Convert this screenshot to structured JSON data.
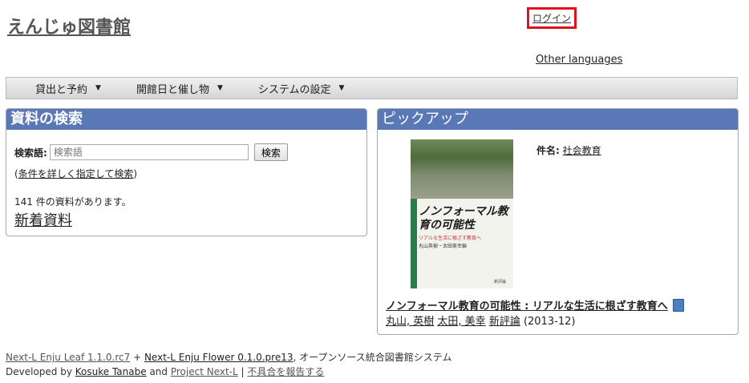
{
  "header": {
    "site_title": "えんじゅ図書館",
    "login_label": "ログイン",
    "other_languages": "Other languages"
  },
  "menu": {
    "items": [
      {
        "label": "貸出と予約"
      },
      {
        "label": "開館日と催し物"
      },
      {
        "label": "システムの設定"
      }
    ]
  },
  "search_panel": {
    "title": "資料の検索",
    "label": "検索語",
    "colon": ":",
    "placeholder": "検索語",
    "button": "検索",
    "advanced_link": "条件を詳しく指定して検索",
    "open_paren": "(",
    "close_paren": ")",
    "count_text": "141 件の資料があります。",
    "new_items_link": "新着資料"
  },
  "pickup_panel": {
    "title": "ピックアップ",
    "subject_label": "件名:",
    "subject_value": "社会教育",
    "cover": {
      "title": "ノンフォーマル教育の可能性",
      "subtitle": "リアルな生活に根ざす教育へ",
      "authors": "丸山英樹・太田美幸編",
      "publisher": "新評論"
    },
    "book_title": "ノンフォーマル教育の可能性 : リアルな生活に根ざす教育へ",
    "author1": "丸山, 英樹",
    "author2": "太田, 美幸",
    "publisher": "新評論",
    "date": "(2013-12)"
  },
  "footer": {
    "leaf": "Next-L Enju Leaf 1.1.0.rc7",
    "plus": "+",
    "flower": "Next-L Enju Flower 0.1.0.pre13",
    "tail": ", オープンソース統合図書館システム",
    "developed_by": "Developed by",
    "developer": "Kosuke Tanabe",
    "and": "and",
    "project": "Project Next-L",
    "sep": "|",
    "report": "不具合を報告する"
  },
  "colors": {
    "panel_header": "#5a77b6",
    "login_highlight": "#e0121b"
  }
}
